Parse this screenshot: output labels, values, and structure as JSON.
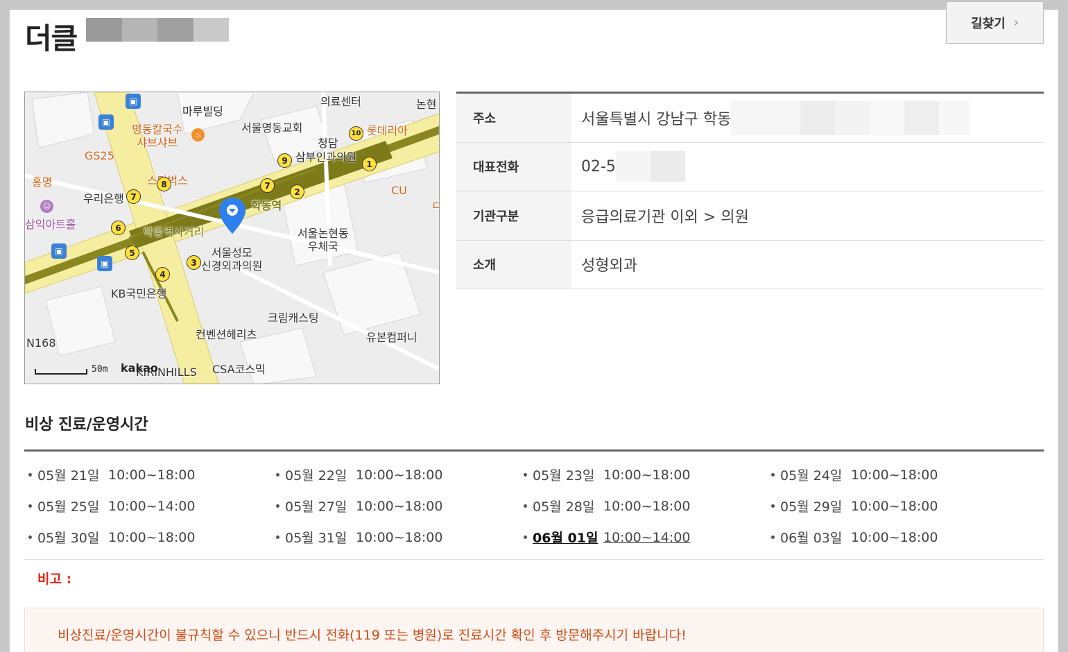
{
  "page": {
    "title": "더클",
    "route_button": "길찾기",
    "mask_colors": [
      "#9a9a9a",
      "#b5b5b5",
      "#a0a0a0",
      "#c9c9c9"
    ]
  },
  "map": {
    "labels": {
      "maru": "마루빌딩",
      "church": "서울영동교회",
      "medical": "의료센터",
      "nonhyeon": "논현",
      "myeongdong": "명동칼국수\n샤브샤브",
      "gs25": "GS25",
      "lotteria": "롯데리아",
      "cheongdam": "청담",
      "sabu": "삼부인과의원",
      "hongmyeong": "홍명",
      "starbucks": "스타벅스",
      "woori": "우리은행",
      "cu": "CU",
      "hakdong_station": "학동역",
      "samik": "삼익아트홀",
      "hakdong_crossroad": "학동역사거리",
      "post": "서울논현동\n우체국",
      "clinic": "서울성모\n신경외과의원",
      "kb": "KB국민은행",
      "cream": "크림캐스팅",
      "n168": "N168",
      "convention": "컨벤션헤리츠",
      "yubon": "유본컴퍼니",
      "csa": "CSA코스믹",
      "kirin": "KIRINHILLS",
      "d": "ㄷ"
    },
    "exits": [
      "1",
      "2",
      "3",
      "4",
      "5",
      "6",
      "7",
      "7",
      "8",
      "9",
      "10"
    ],
    "scale": "50m",
    "provider": "kakao"
  },
  "info": {
    "rows": [
      {
        "label": "주소",
        "value": "서울특별시 강남구 학동"
      },
      {
        "label": "대표전화",
        "value": "02-5"
      },
      {
        "label": "기관구분",
        "value": "응급의료기관 이외 > 의원"
      },
      {
        "label": "소개",
        "value": "성형외과"
      }
    ]
  },
  "hours": {
    "title": "비상 진료/운영시간",
    "items": [
      {
        "day": "05월 21일",
        "time": "10:00~18:00"
      },
      {
        "day": "05월 22일",
        "time": "10:00~18:00"
      },
      {
        "day": "05월 23일",
        "time": "10:00~18:00"
      },
      {
        "day": "05월 24일",
        "time": "10:00~18:00"
      },
      {
        "day": "05월 25일",
        "time": "10:00~14:00"
      },
      {
        "day": "05월 27일",
        "time": "10:00~18:00"
      },
      {
        "day": "05월 28일",
        "time": "10:00~18:00"
      },
      {
        "day": "05월 29일",
        "time": "10:00~18:00"
      },
      {
        "day": "05월 30일",
        "time": "10:00~18:00"
      },
      {
        "day": "05월 31일",
        "time": "10:00~18:00"
      },
      {
        "day": "06월 01일",
        "time": "10:00~14:00",
        "today": true
      },
      {
        "day": "06월 03일",
        "time": "10:00~18:00"
      }
    ]
  },
  "note": {
    "label": "비고 :",
    "warning": "비상진료/운영시간이 불규칙할 수 있으니 반드시 전화(119 또는 병원)로 진료시간 확인 후 방문해주시기 바랍니다!"
  },
  "colors": {
    "accent_red": "#e8200e",
    "warning_text": "#d24a12",
    "map_road": "#f5eda0",
    "map_subway": "#8a8620"
  }
}
